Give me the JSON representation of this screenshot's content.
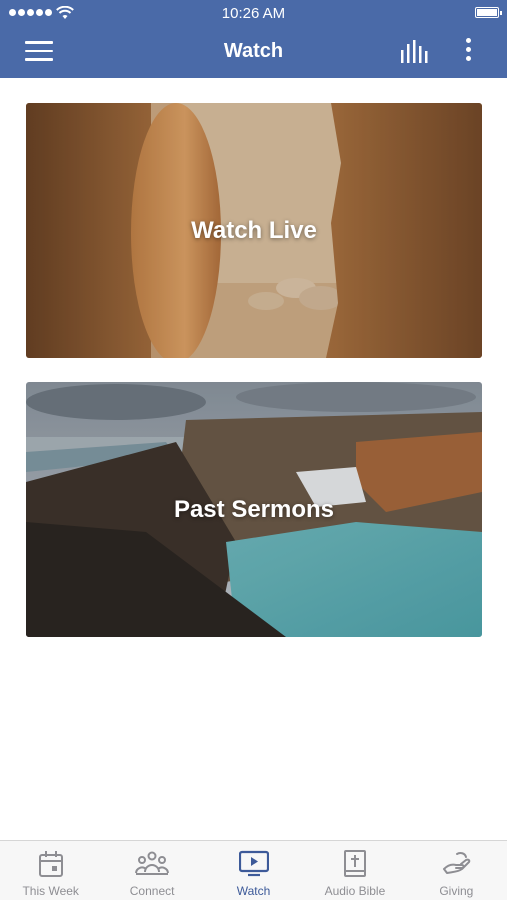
{
  "status_bar": {
    "time": "10:26 AM"
  },
  "nav": {
    "title": "Watch"
  },
  "cards": {
    "watch_live": "Watch Live",
    "past_sermons": "Past Sermons"
  },
  "tabs": [
    {
      "label": "This Week",
      "icon": "calendar-icon"
    },
    {
      "label": "Connect",
      "icon": "people-icon"
    },
    {
      "label": "Watch",
      "icon": "tv-play-icon",
      "active": true
    },
    {
      "label": "Audio Bible",
      "icon": "bible-icon"
    },
    {
      "label": "Giving",
      "icon": "giving-hand-icon"
    }
  ],
  "colors": {
    "header": "#4a6aa8",
    "active_tab": "#3d5a99",
    "inactive_tab": "#8e8e93"
  }
}
